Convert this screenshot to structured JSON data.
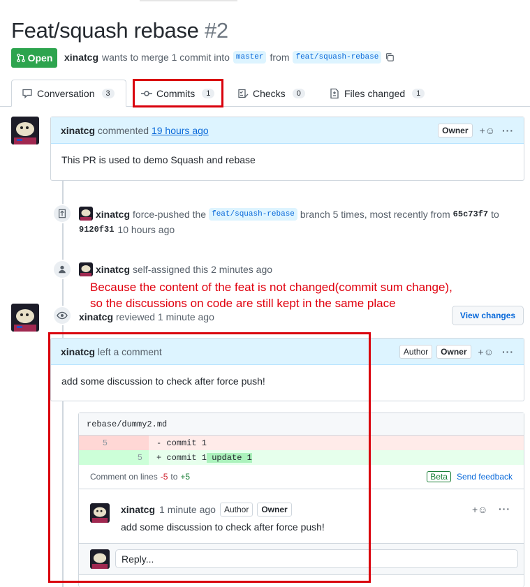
{
  "pr": {
    "title": "Feat/squash rebase",
    "number": "#2",
    "state": "Open",
    "author": "xinatcg",
    "merge_text": "wants to merge 1 commit into",
    "base_branch": "master",
    "from_text": "from",
    "head_branch": "feat/squash-rebase"
  },
  "tabs": [
    {
      "label": "Conversation",
      "count": "3"
    },
    {
      "label": "Commits",
      "count": "1"
    },
    {
      "label": "Checks",
      "count": "0"
    },
    {
      "label": "Files changed",
      "count": "1"
    }
  ],
  "first_comment": {
    "author": "xinatcg",
    "action": "commented",
    "time": "19 hours ago",
    "role": "Owner",
    "body": "This PR is used to demo Squash and rebase"
  },
  "force_push_event": {
    "author": "xinatcg",
    "text1": "force-pushed the",
    "branch": "feat/squash-rebase",
    "text2": "branch 5 times, most recently from",
    "from_sha": "65c73f7",
    "to_text": "to",
    "to_sha": "9120f31",
    "time": "10 hours ago"
  },
  "assign_event": {
    "author": "xinatcg",
    "text": "self-assigned this 2 minutes ago"
  },
  "annotation": {
    "line1": "Because the content of the feat is not changed(commit sum change),",
    "line2": "so the discussions on code are still kept in the same place"
  },
  "review": {
    "author": "xinatcg",
    "text": "reviewed 1 minute ago",
    "view_changes": "View changes",
    "comment_author": "xinatcg",
    "comment_action": "left a comment",
    "role_author": "Author",
    "role_owner": "Owner",
    "body": "add some discussion to check after force push!"
  },
  "diff": {
    "file": "rebase/dummy2.md",
    "del_line_no": "5",
    "del_code": "- commit 1",
    "add_line_no": "5",
    "add_code_prefix": "+ commit 1",
    "add_code_hl": " update 1",
    "lines_label": "Comment on lines",
    "from_line": "-5",
    "to_text": "to",
    "to_line": "+5",
    "beta": "Beta",
    "feedback": "Send feedback"
  },
  "thread_comment": {
    "author": "xinatcg",
    "time": "1 minute ago",
    "role_author": "Author",
    "role_owner": "Owner",
    "body": "add some discussion to check after force push!"
  },
  "reply": {
    "placeholder": "Reply..."
  },
  "colors": {
    "open_green": "#2da44e",
    "annotation_red": "#e0000e",
    "link_blue": "#0969da"
  }
}
